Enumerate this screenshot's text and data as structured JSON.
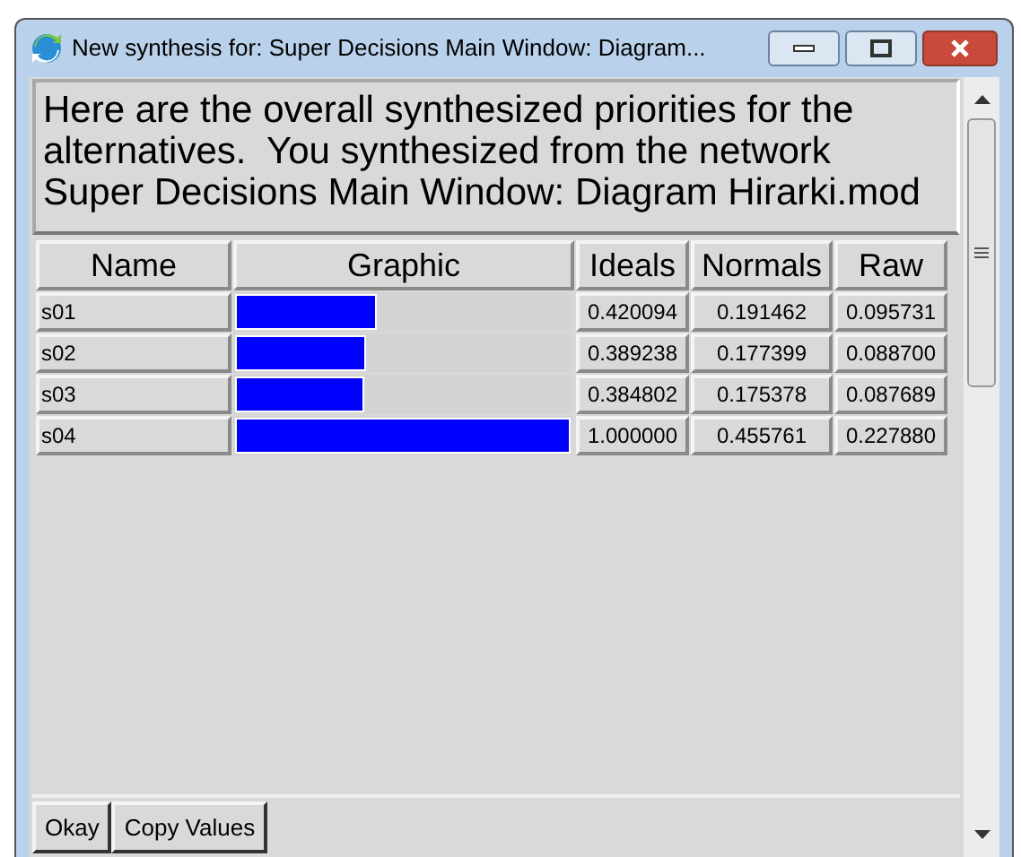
{
  "window": {
    "title": "New synthesis for: Super Decisions Main Window: Diagram..."
  },
  "message": "Here are the overall synthesized priorities for the alternatives.  You synthesized from the network Super Decisions Main Window: Diagram Hirarki.mod",
  "table": {
    "columns": [
      "Name",
      "Graphic",
      "Ideals",
      "Normals",
      "Raw"
    ],
    "rows": [
      {
        "name": "s01",
        "level": 0.420094,
        "ideals": "0.420094",
        "normals": "0.191462",
        "raw": "0.095731"
      },
      {
        "name": "s02",
        "level": 0.389238,
        "ideals": "0.389238",
        "normals": "0.177399",
        "raw": "0.088700"
      },
      {
        "name": "s03",
        "level": 0.384802,
        "ideals": "0.384802",
        "normals": "0.175378",
        "raw": "0.087689"
      },
      {
        "name": "s04",
        "level": 1.0,
        "ideals": "1.000000",
        "normals": "0.455761",
        "raw": "0.227880"
      }
    ]
  },
  "buttons": [
    "Okay",
    "Copy Values"
  ]
}
